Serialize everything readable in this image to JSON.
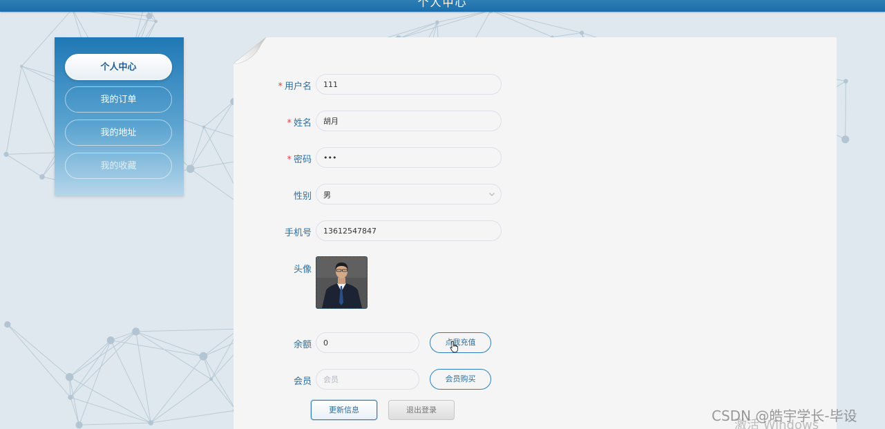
{
  "header": {
    "title": "个人中心"
  },
  "sidebar": {
    "items": [
      {
        "label": "个人中心",
        "active": true
      },
      {
        "label": "我的订单",
        "active": false
      },
      {
        "label": "我的地址",
        "active": false
      },
      {
        "label": "我的收藏",
        "active": false
      }
    ]
  },
  "form": {
    "required_mark": "*",
    "username": {
      "label": "用户名",
      "value": "111"
    },
    "name": {
      "label": "姓名",
      "value": "胡月"
    },
    "password": {
      "label": "密码",
      "value": "•••"
    },
    "gender": {
      "label": "性别",
      "value": "男"
    },
    "phone": {
      "label": "手机号",
      "value": "13612547847"
    },
    "avatar": {
      "label": "头像"
    },
    "balance": {
      "label": "余额",
      "value": "0",
      "button": "点我充值"
    },
    "vip": {
      "label": "会员",
      "placeholder": "会员",
      "button": "会员购买"
    }
  },
  "actions": {
    "update": "更新信息",
    "logout": "退出登录"
  },
  "watermarks": {
    "csdn": "CSDN @皓宇学长-毕设",
    "windows": "激活 Windows"
  },
  "colors": {
    "accent": "#1f78b5",
    "label": "#2d6e9e",
    "required": "#e53e3e"
  }
}
